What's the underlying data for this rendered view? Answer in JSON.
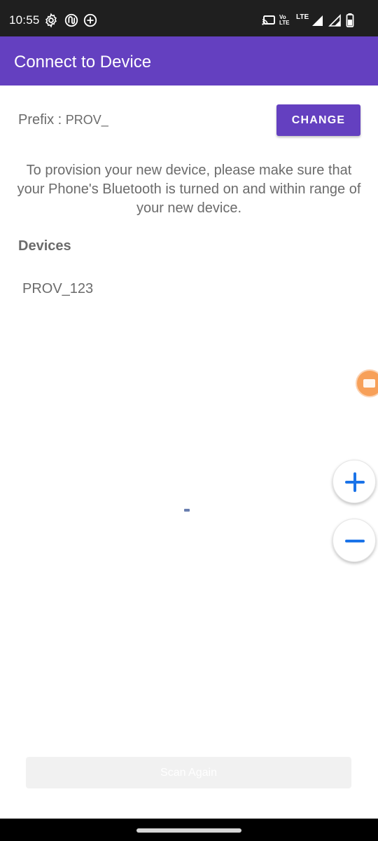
{
  "status_bar": {
    "time": "10:55",
    "icons": [
      "settings-icon",
      "app-notification-icon",
      "add-circle-icon",
      "cast-icon",
      "volte-icon",
      "lte-icon",
      "signal-icon",
      "signal-icon-2",
      "battery-icon"
    ],
    "volte_label": "Vo LTE",
    "lte_label": "LTE"
  },
  "app_bar": {
    "title": "Connect to Device",
    "color": "#6440c0"
  },
  "prefix": {
    "label": "Prefix : ",
    "value": "PROV_",
    "change_button": "CHANGE"
  },
  "instructions": "To provision your new device, please make sure that your Phone's Bluetooth is turned on and within range of your new device.",
  "devices": {
    "heading": "Devices",
    "items": [
      "PROV_123"
    ]
  },
  "floating_controls": {
    "bubble_icon": "video-bubble-icon",
    "zoom_in_icon": "plus-icon",
    "zoom_out_icon": "minus-icon",
    "accent": "#1a73e8"
  },
  "footer": {
    "scan_button": "Scan Again"
  }
}
